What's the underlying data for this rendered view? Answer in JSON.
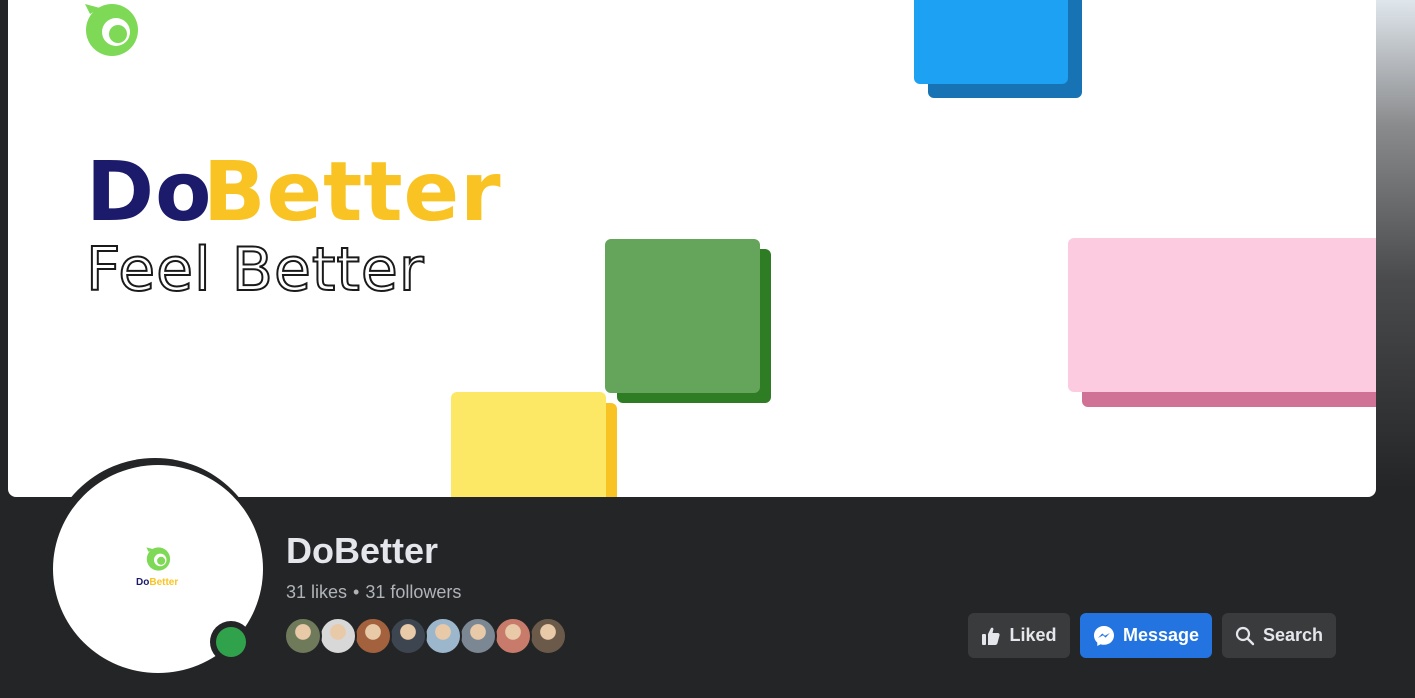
{
  "cover": {
    "brand_do": "Do",
    "brand_better": "Better",
    "tagline": "Feel Better",
    "colors": {
      "navy": "#1c1a6b",
      "yellow": "#f9c423",
      "green_logo": "#7ed957",
      "blue": "#1da1f2",
      "green_block": "#65a45b",
      "yellow_block": "#fde865",
      "pink_block": "#fccbe0"
    }
  },
  "profile": {
    "avatar_brand_do": "Do",
    "avatar_brand_better": "Better",
    "status": "online"
  },
  "page": {
    "name": "DoBetter",
    "likes_text": "31 likes",
    "separator": "•",
    "followers_text": "31 followers"
  },
  "friends": [
    {
      "name": "friend-avatar-1",
      "color": "#6f7a5b"
    },
    {
      "name": "friend-avatar-2",
      "color": "#d8d8d8"
    },
    {
      "name": "friend-avatar-3",
      "color": "#a3623d"
    },
    {
      "name": "friend-avatar-4",
      "color": "#3d4650"
    },
    {
      "name": "friend-avatar-5",
      "color": "#9cb6cc"
    },
    {
      "name": "friend-avatar-6",
      "color": "#7c8794"
    },
    {
      "name": "friend-avatar-7",
      "color": "#c87b6a"
    },
    {
      "name": "friend-avatar-8",
      "color": "#6b5a4a"
    }
  ],
  "actions": {
    "liked": "Liked",
    "message": "Message",
    "search": "Search"
  },
  "icons": {
    "liked": "thumbs-up-icon",
    "message": "messenger-icon",
    "search": "search-icon"
  }
}
